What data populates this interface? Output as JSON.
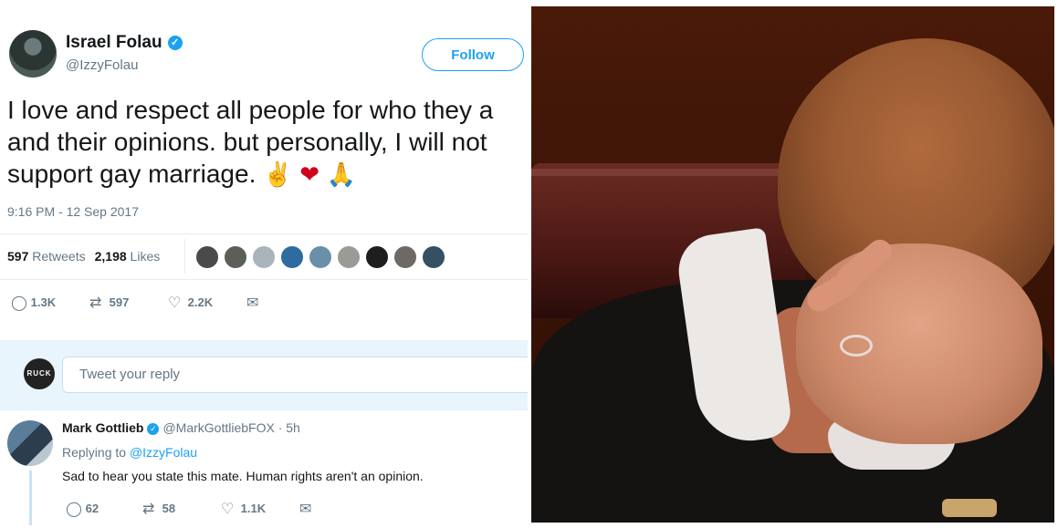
{
  "tweet": {
    "author_name": "Israel Folau",
    "author_handle": "@IzzyFolau",
    "follow_label": "Follow",
    "text_lines": [
      "I love and respect all people for who they a",
      "and their opinions. but personally, I will not",
      "support gay marriage."
    ],
    "emojis": [
      "✌",
      "❤",
      "🙏"
    ],
    "timestamp": "9:16 PM - 12 Sep 2017",
    "retweets_count": "597",
    "retweets_label": "Retweets",
    "likes_count": "2,198",
    "likes_label": "Likes",
    "actions": {
      "reply_count": "1.3K",
      "retweet_count": "597",
      "like_count": "2.2K"
    }
  },
  "reply_box": {
    "avatar_text": "RUCK",
    "placeholder": "Tweet your reply"
  },
  "reply": {
    "author_name": "Mark Gottlieb",
    "author_handle": "@MarkGottliebFOX",
    "time": "· 5h",
    "replying_prefix": "Replying to",
    "replying_to": "@IzzyFolau",
    "text": "Sad to hear you state this mate. Human rights aren't an opinion.",
    "actions": {
      "reply_count": "62",
      "retweet_count": "58",
      "like_count": "1.1K"
    }
  },
  "colors": {
    "accent": "#1da1f2",
    "muted": "#657786",
    "reply_bar": "#e8f5fd"
  }
}
